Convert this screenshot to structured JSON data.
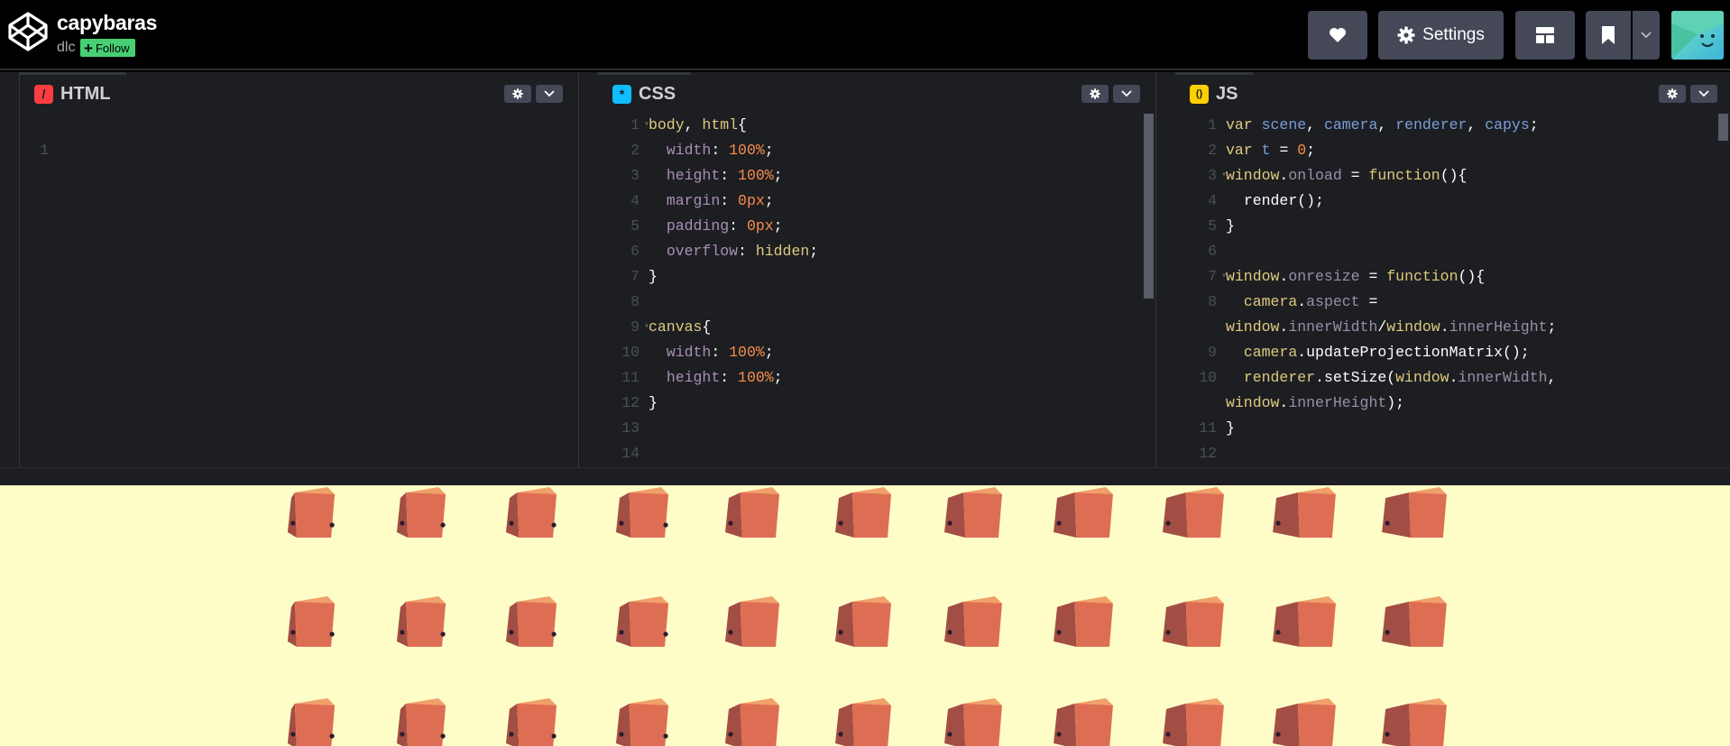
{
  "header": {
    "title": "capybaras",
    "author": "dlc",
    "follow_label": "Follow",
    "settings_label": "Settings",
    "icons": {
      "logo": "codepen-logo-icon",
      "love": "heart-icon",
      "settings": "gear-icon",
      "layout": "layout-grid-icon",
      "bookmark": "bookmark-icon",
      "dropdown": "chevron-down-icon"
    }
  },
  "editors": {
    "html": {
      "label": "HTML",
      "icon_glyph": "/",
      "icon_color": "#ff3c41",
      "lines": [
        ""
      ]
    },
    "css": {
      "label": "CSS",
      "icon_glyph": "*",
      "icon_color": "#0ebeff",
      "lines": [
        "body, html{",
        "  width: 100%;",
        "  height: 100%;",
        "  margin: 0px;",
        "  padding: 0px;",
        "  overflow: hidden;",
        "}",
        "",
        "canvas{",
        "  width: 100%;",
        "  height: 100%;",
        "}",
        "",
        ""
      ]
    },
    "js": {
      "label": "JS",
      "icon_glyph": "()",
      "icon_color": "#fcd000",
      "lines": [
        "var scene, camera, renderer, capys;",
        "var t = 0;",
        "window.onload = function(){",
        "  render();",
        "}",
        "",
        "window.onresize = function(){",
        "  camera.aspect =",
        "window.innerWidth/window.innerHeight;",
        "  camera.updateProjectionMatrix();",
        "  renderer.setSize(window.innerWidth,",
        "window.innerHeight);",
        "}",
        ""
      ],
      "line_numbers": [
        "1",
        "2",
        "3",
        "4",
        "5",
        "6",
        "7",
        "8",
        "",
        "9",
        "10",
        "",
        "11",
        "12"
      ]
    }
  },
  "colors": {
    "background": "#000000",
    "editor_bg": "#1d1e22",
    "button_bg": "#444857",
    "follow_green": "#47cf73",
    "preview_bg": "#fefdc8",
    "capy_light": "#de6e53",
    "capy_dark": "#a34e44",
    "capy_top": "#f0a06a",
    "capy_eye": "#2a1c2e"
  }
}
